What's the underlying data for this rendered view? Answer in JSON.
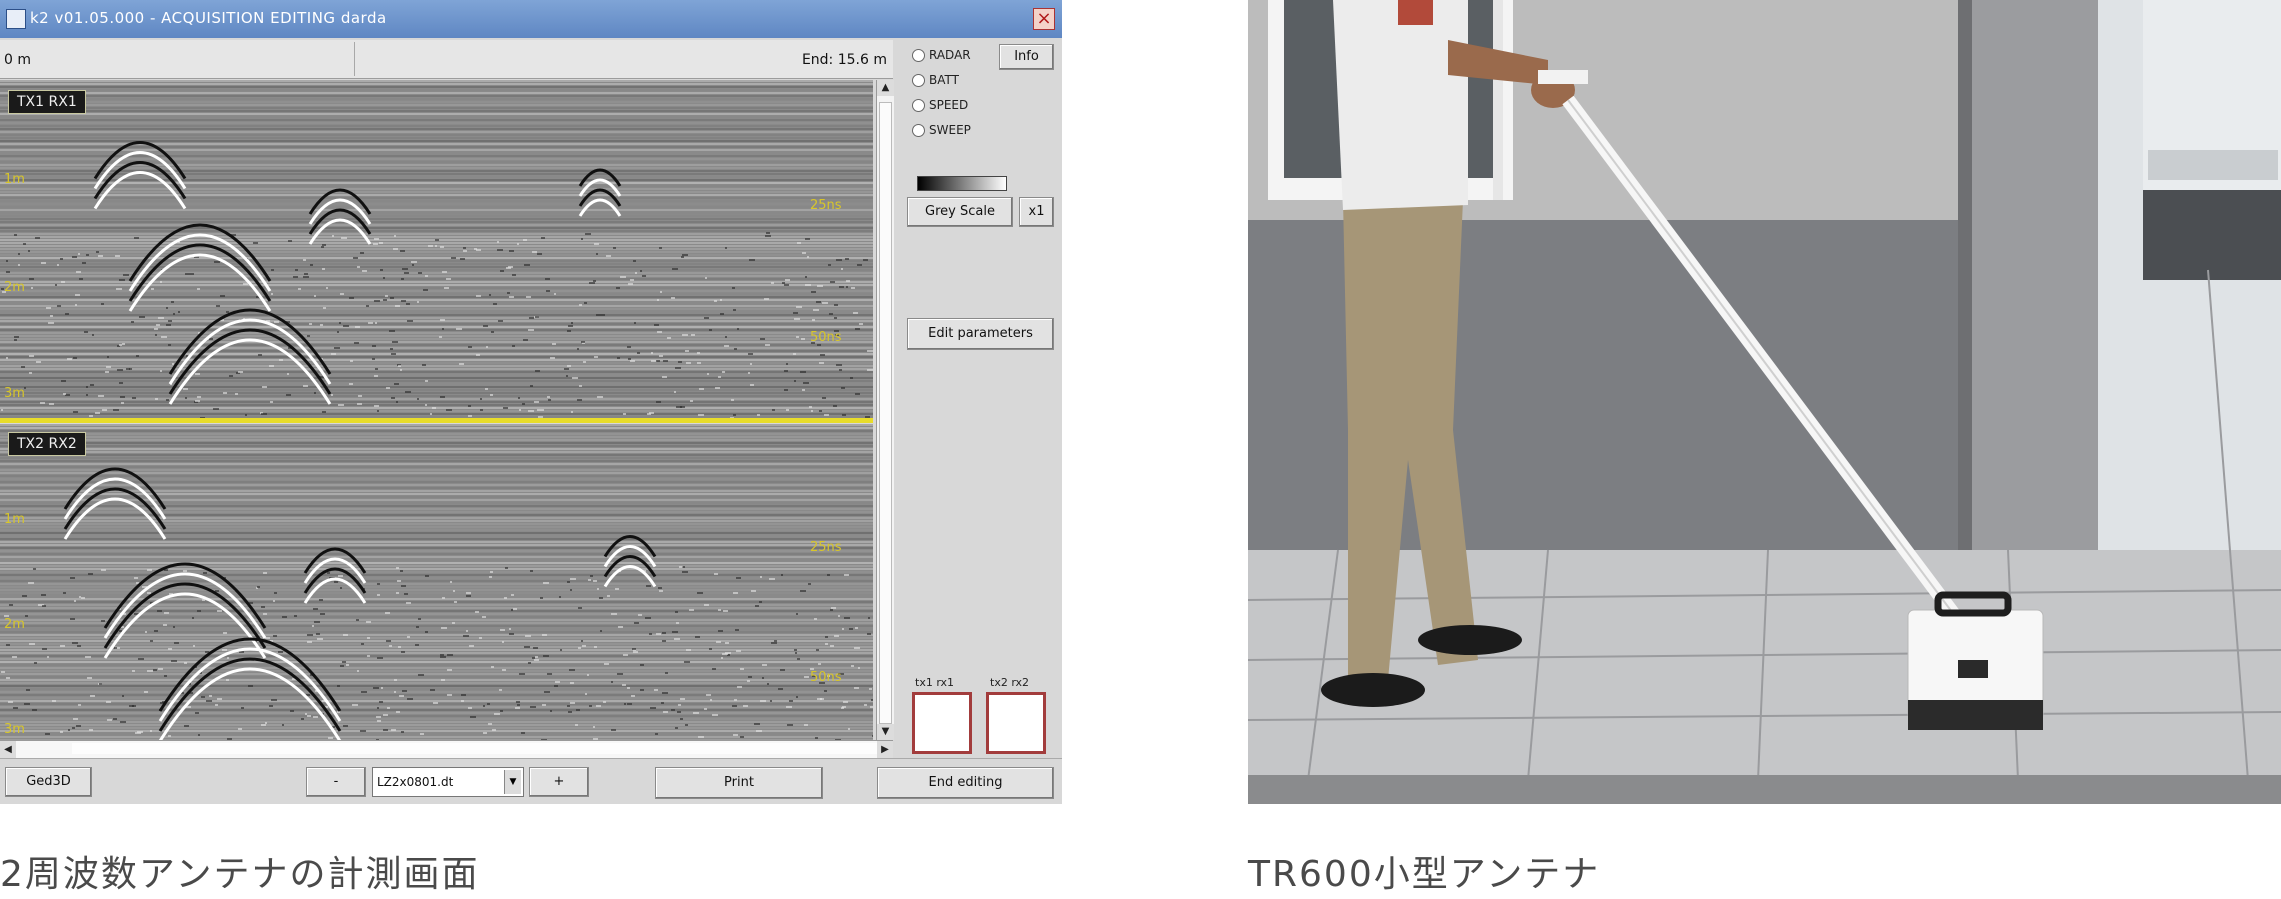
{
  "window": {
    "title": "k2 v01.05.000 - ACQUISITION EDITING  darda",
    "close_glyph": "×"
  },
  "distance": {
    "start": "0 m",
    "end": "End: 15.6 m"
  },
  "panels": [
    {
      "label": "TX1 RX1",
      "depths": [
        "1m",
        "2m",
        "3m"
      ],
      "times": [
        "25ns",
        "50ns"
      ]
    },
    {
      "label": "TX2 RX2",
      "depths": [
        "1m",
        "2m",
        "3m"
      ],
      "times": [
        "25ns",
        "50ns"
      ]
    }
  ],
  "status": {
    "items": [
      "RADAR",
      "BATT",
      "SPEED",
      "SWEEP"
    ]
  },
  "buttons": {
    "info": "Info",
    "grey_scale": "Grey Scale",
    "x1": "x1",
    "edit_parameters": "Edit parameters",
    "georad": "Ged3D",
    "minus": "-",
    "plus": "+",
    "print": "Print",
    "end_editing": "End editing"
  },
  "file": {
    "selected": "LZ2x0801.dt"
  },
  "mini_labels": [
    "tx1 rx1",
    "tx2 rx2"
  ],
  "captions": {
    "left": "2周波数アンテナの計測画面",
    "right": "TR600小型アンテナ"
  },
  "colors": {
    "accent_yellow": "#e8dc2a",
    "title_blue": "#6f95cc",
    "box_red": "#a23c3c"
  },
  "icons": [
    "app-icon",
    "close-icon",
    "radio-icon",
    "scroll-arrow-icon",
    "dropdown-arrow-icon"
  ]
}
